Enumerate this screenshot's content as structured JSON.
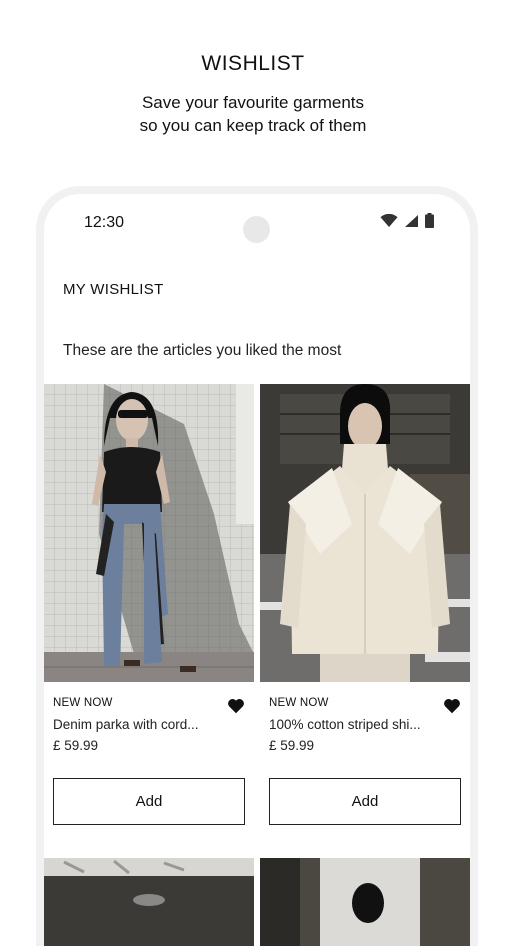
{
  "promo": {
    "title": "WISHLIST",
    "subtitle_line1": "Save your favourite garments",
    "subtitle_line2": "so you can keep track of them"
  },
  "status_bar": {
    "time": "12:30",
    "icons": [
      "wifi-icon",
      "signal-icon",
      "battery-icon"
    ]
  },
  "wishlist": {
    "title": "MY WISHLIST",
    "description": "These are the articles you liked the most",
    "products": [
      {
        "badge": "NEW NOW",
        "name": "Denim parka with cord...",
        "price": "£ 59.99",
        "add_label": "Add",
        "favourited": true,
        "image": "woman-black-top-blue-wide-trousers"
      },
      {
        "badge": "NEW NOW",
        "name": "100% cotton striped shi...",
        "price": "£ 59.99",
        "add_label": "Add",
        "favourited": true,
        "image": "woman-cream-wide-collar-jacket"
      }
    ]
  },
  "colors": {
    "text": "#111111",
    "phone_frame": "#f1f1f1",
    "button_border": "#222222"
  }
}
